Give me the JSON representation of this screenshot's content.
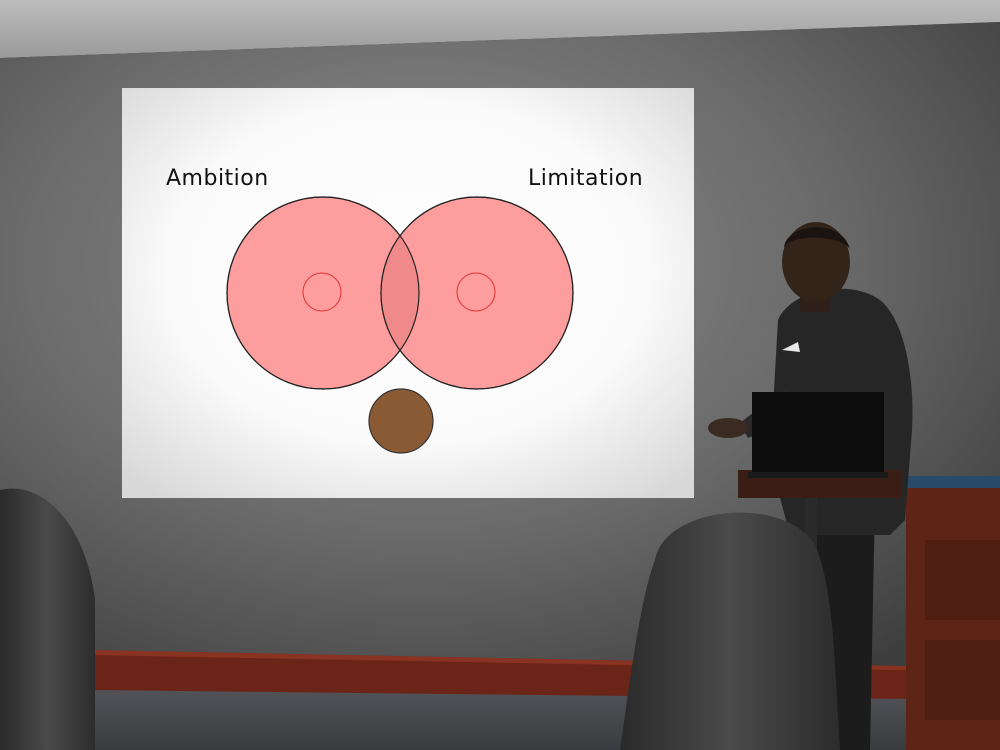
{
  "slide": {
    "left_label": "Ambition",
    "right_label": "Limitation"
  },
  "colors": {
    "wall": "#6d6d6d",
    "screen": "#ffffff",
    "circle_fill": "#ff9a9a",
    "circle_stroke": "#222222",
    "inner_circle_stroke": "#e03030",
    "small_circle_fill": "#8a5a35",
    "baseboard": "#6b2418",
    "carpet": "#4a4c52",
    "presenter_suit": "#262626",
    "cabinet": "#6a2a1a"
  }
}
